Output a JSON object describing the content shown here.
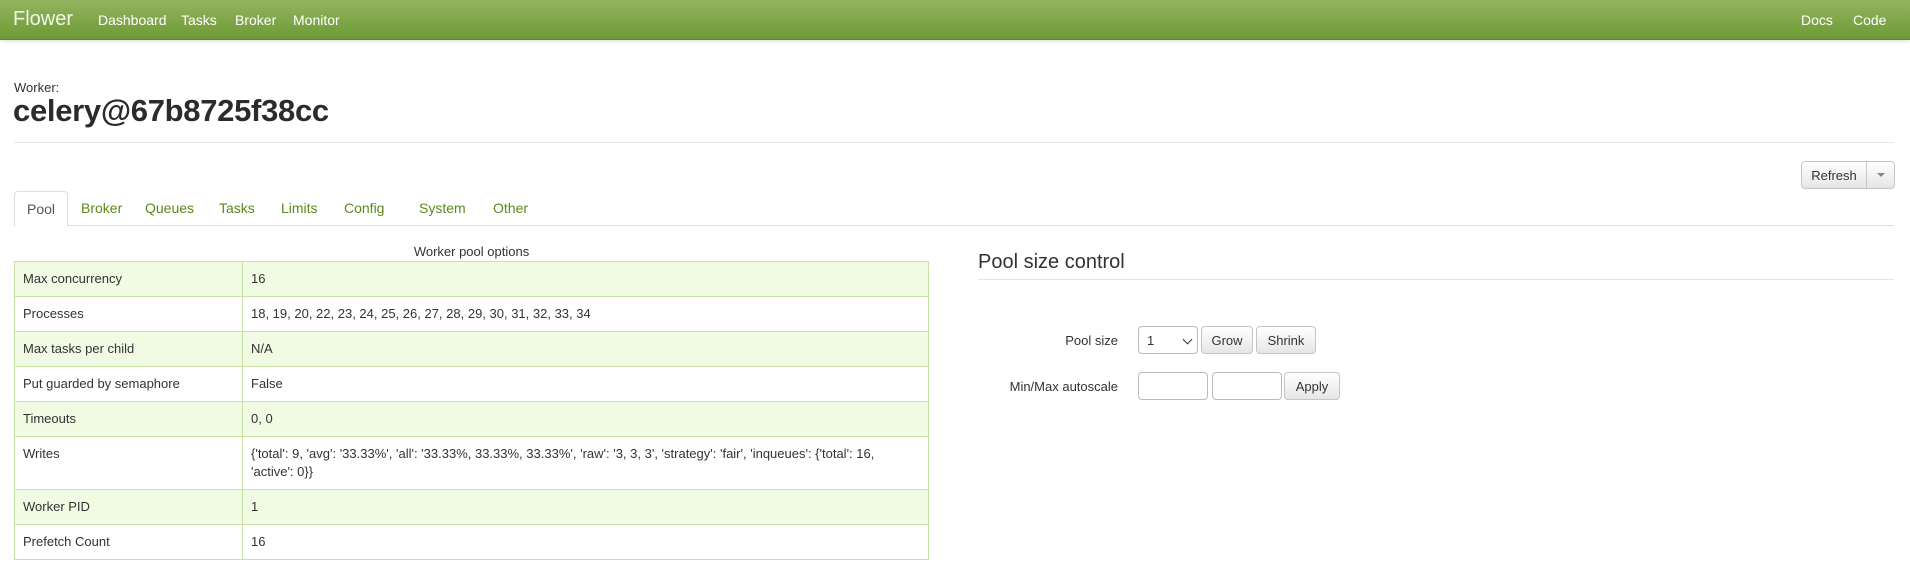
{
  "navbar": {
    "brand": "Flower",
    "links": [
      "Dashboard",
      "Tasks",
      "Broker",
      "Monitor"
    ],
    "right_links": [
      "Docs",
      "Code"
    ]
  },
  "header": {
    "label": "Worker:",
    "name": "celery@67b8725f38cc"
  },
  "toolbar": {
    "refresh_label": "Refresh"
  },
  "tabs": [
    "Pool",
    "Broker",
    "Queues",
    "Tasks",
    "Limits",
    "Config",
    "System",
    "Other"
  ],
  "pool_options": {
    "caption": "Worker pool options",
    "rows": [
      {
        "key": "Max concurrency",
        "value": "16"
      },
      {
        "key": "Processes",
        "value": "18, 19, 20, 22, 23, 24, 25, 26, 27, 28, 29, 30, 31, 32, 33, 34"
      },
      {
        "key": "Max tasks per child",
        "value": "N/A"
      },
      {
        "key": "Put guarded by semaphore",
        "value": "False"
      },
      {
        "key": "Timeouts",
        "value": "0, 0"
      },
      {
        "key": "Writes",
        "value": "{'total': 9, 'avg': '33.33%', 'all': '33.33%, 33.33%, 33.33%', 'raw': '3, 3, 3', 'strategy': 'fair', 'inqueues': {'total': 16, 'active': 0}}"
      },
      {
        "key": "Worker PID",
        "value": "1"
      },
      {
        "key": "Prefetch Count",
        "value": "16"
      }
    ]
  },
  "pool_control": {
    "title": "Pool size control",
    "pool_size_label": "Pool size",
    "pool_size_value": "1",
    "grow_label": "Grow",
    "shrink_label": "Shrink",
    "autoscale_label": "Min/Max autoscale",
    "min_value": "",
    "max_value": "",
    "apply_label": "Apply"
  },
  "colors": {
    "navbar": "#7ea647",
    "tab_link": "#5a8a1a",
    "row_highlight": "#f1fbe4",
    "table_border": "#c9e2a8"
  }
}
